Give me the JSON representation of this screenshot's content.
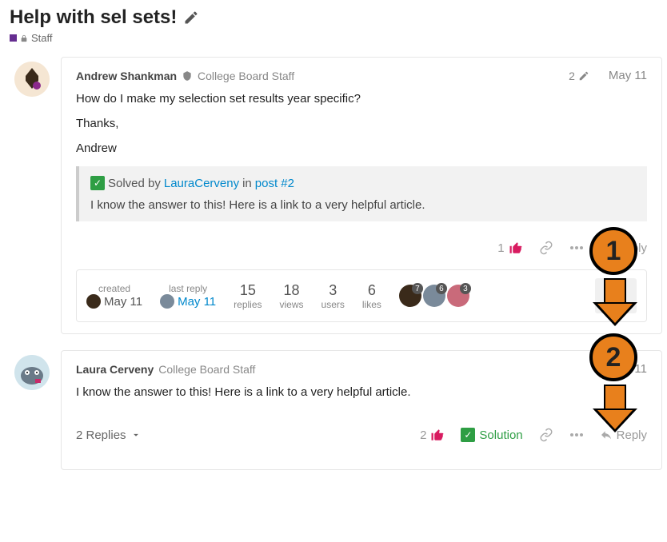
{
  "topic": {
    "title": "Help with sel sets!",
    "category": "Staff"
  },
  "posts": [
    {
      "author": "Andrew Shankman",
      "author_title": "College Board Staff",
      "edit_count": "2",
      "date": "May 11",
      "body_lines": [
        "How do I make my selection set results year specific?",
        "Thanks,",
        "Andrew"
      ],
      "solved": {
        "prefix": "Solved by",
        "solver": "LauraCerveny",
        "in_word": "in",
        "post_ref": "post #2",
        "preview": "I know the answer to this! Here is a link to a very helpful article."
      },
      "like_count": "1",
      "reply_label": "Reply",
      "stats": {
        "created_label": "created",
        "created_date": "May 11",
        "lastreply_label": "last reply",
        "lastreply_date": "May 11",
        "replies_n": "15",
        "replies_l": "replies",
        "views_n": "18",
        "views_l": "views",
        "users_n": "3",
        "users_l": "users",
        "likes_n": "6",
        "likes_l": "likes",
        "participant_badges": [
          "7",
          "6",
          "3"
        ]
      }
    },
    {
      "author": "Laura Cerveny",
      "author_title": "College Board Staff",
      "date": "May 11",
      "body_lines": [
        "I know the answer to this! Here is a link to a very helpful article."
      ],
      "replies_toggle": "2 Replies",
      "like_count": "2",
      "solution_label": "Solution",
      "reply_label": "Reply"
    }
  ],
  "markers": {
    "m1": "1",
    "m2": "2"
  }
}
